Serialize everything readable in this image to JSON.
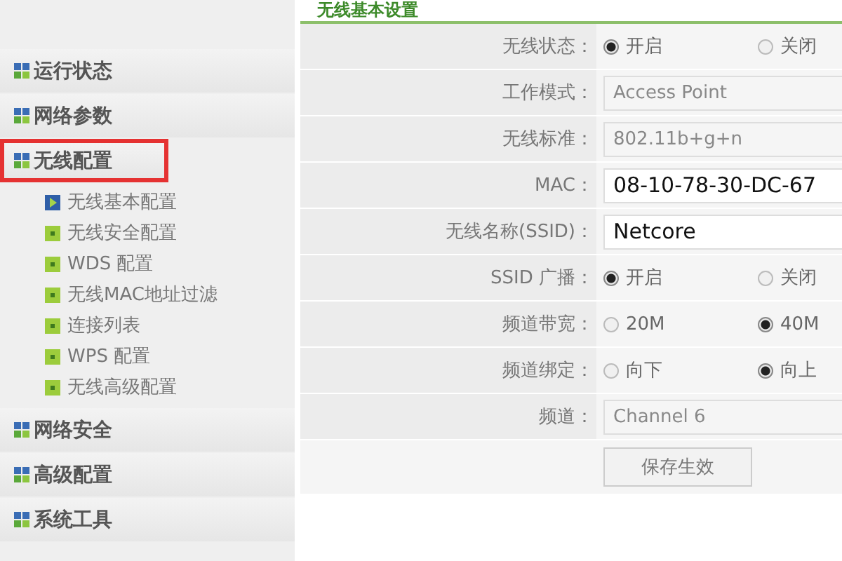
{
  "sidebar": {
    "items": [
      {
        "label": "运行状态",
        "highlighted": false
      },
      {
        "label": "网络参数",
        "highlighted": false
      },
      {
        "label": "无线配置",
        "highlighted": true,
        "children": [
          {
            "label": "无线基本配置",
            "selected": true
          },
          {
            "label": "无线安全配置",
            "selected": false
          },
          {
            "label": "WDS 配置",
            "selected": false
          },
          {
            "label": "无线MAC地址过滤",
            "selected": false
          },
          {
            "label": "连接列表",
            "selected": false
          },
          {
            "label": "WPS 配置",
            "selected": false
          },
          {
            "label": "无线高级配置",
            "selected": false
          }
        ]
      },
      {
        "label": "网络安全",
        "highlighted": false
      },
      {
        "label": "高级配置",
        "highlighted": false
      },
      {
        "label": "系统工具",
        "highlighted": false
      }
    ]
  },
  "section_title": "无线基本设置",
  "form": {
    "rows": [
      {
        "kind": "radio",
        "label": "无线状态：",
        "options": [
          {
            "label": "开启",
            "selected": true
          },
          {
            "label": "关闭",
            "selected": false
          }
        ]
      },
      {
        "kind": "select",
        "label": "工作模式：",
        "value": "Access Point"
      },
      {
        "kind": "select",
        "label": "无线标准：",
        "value": "802.11b+g+n"
      },
      {
        "kind": "text",
        "label": "MAC：",
        "value": "08-10-78-30-DC-67"
      },
      {
        "kind": "text",
        "label": "无线名称(SSID)：",
        "value": "Netcore"
      },
      {
        "kind": "radio",
        "label": "SSID 广播：",
        "options": [
          {
            "label": "开启",
            "selected": true
          },
          {
            "label": "关闭",
            "selected": false
          }
        ]
      },
      {
        "kind": "radio",
        "label": "频道带宽：",
        "options": [
          {
            "label": "20M",
            "selected": false
          },
          {
            "label": "40M",
            "selected": true
          }
        ]
      },
      {
        "kind": "radio",
        "label": "频道绑定：",
        "options": [
          {
            "label": "向下",
            "selected": false
          },
          {
            "label": "向上",
            "selected": true
          }
        ]
      },
      {
        "kind": "select",
        "label": "频道：",
        "value": "Channel 6"
      }
    ],
    "save_button": "保存生效"
  }
}
